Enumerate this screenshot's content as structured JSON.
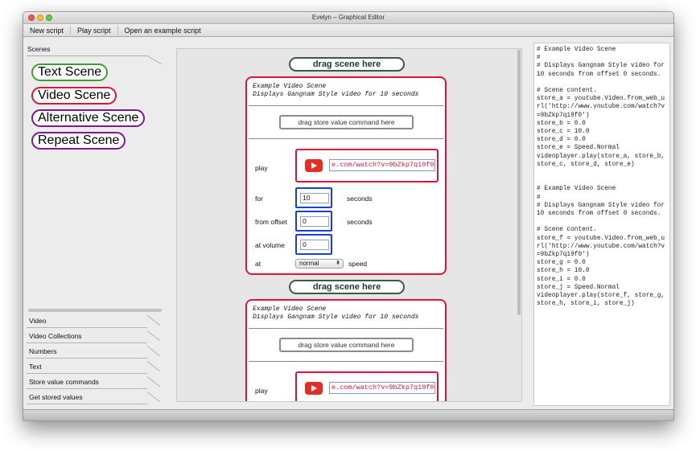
{
  "window": {
    "title": "Evelyn – Graphical Editor"
  },
  "menu": {
    "items": [
      "New script",
      "Play script",
      "Open an example script"
    ]
  },
  "sidebar": {
    "scenes_header": "Scenes",
    "scenes": [
      {
        "label": "Text Scene",
        "color": "#3aa02e"
      },
      {
        "label": "Video Scene",
        "color": "#e0123b"
      },
      {
        "label": "Alternative Scene",
        "color": "#7a1a8c"
      },
      {
        "label": "Repeat Scene",
        "color": "#7a1a8c"
      }
    ],
    "categories": [
      "Video",
      "Video Collections",
      "Numbers",
      "Text",
      "Store value commands",
      "Get stored values"
    ]
  },
  "editor": {
    "drag_label": "drag scene here",
    "store_cmd_label": "drag store value command here",
    "cards": [
      {
        "desc_line1": "Example Video Scene",
        "desc_line2": "Displays Gangnam Style video for 10 seconds",
        "play_label": "play",
        "url": "e.com/watch?v=9bZkp7q19f0",
        "for_label": "for",
        "for_value": "10",
        "for_suffix": "seconds",
        "offset_label": "from offset",
        "offset_value": "0",
        "offset_suffix": "seconds",
        "volume_label": "at volume",
        "volume_value": "0",
        "at_label": "at",
        "speed_value": "normal",
        "speed_suffix": "speed"
      },
      {
        "desc_line1": "Example Video Scene",
        "desc_line2": "Displays Gangnam Style video for 10 seconds",
        "play_label": "play",
        "url": "e.com/watch?v=9bZkp7q19f0"
      }
    ]
  },
  "code": {
    "text": "# Example Video Scene\n#\n# Displays Gangnam Style video for 10 seconds from offset 0 seconds.\n\n# Scene content.\nstore_a = youtube.Video.from_web_url('http://www.youtube.com/watch?v=9bZkp7q19f0')\nstore_b = 0.0\nstore_c = 10.0\nstore_d = 0.0\nstore_e = Speed.Normal\nvideoplayer.play(store_a, store_b, store_c, store_d, store_e)\n\n\n# Example Video Scene\n#\n# Displays Gangnam Style video for 10 seconds from offset 0 seconds.\n\n# Scene content.\nstore_f = youtube.Video.from_web_url('http://www.youtube.com/watch?v=9bZkp7q19f0')\nstore_g = 0.0\nstore_h = 10.0\nstore_i = 0.0\nstore_j = Speed.Normal\nvideoplayer.play(store_f, store_g, store_h, store_i, store_j)"
  }
}
